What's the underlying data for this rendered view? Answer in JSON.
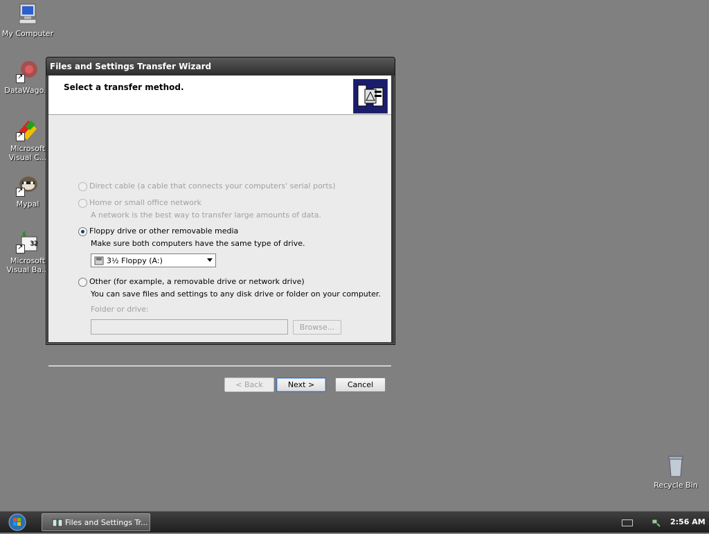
{
  "desktop": {
    "icons": [
      {
        "label": "My Computer",
        "icon": "computer-icon"
      },
      {
        "label": "DataWago...",
        "icon": "datawago-icon"
      },
      {
        "label": "Microsoft\nVisual C...",
        "label1": "Microsoft",
        "label2": "Visual C...",
        "icon": "visual-c-icon"
      },
      {
        "label": "Mypal",
        "icon": "mypal-icon"
      },
      {
        "label1": "Microsoft",
        "label2": "Visual Ba...",
        "icon": "visual-basic-icon"
      },
      {
        "label": "Recycle Bin",
        "icon": "recycle-bin-icon"
      }
    ]
  },
  "window": {
    "title": "Files and Settings Transfer Wizard",
    "heading": "Select a transfer method.",
    "options": [
      {
        "label": "Direct cable (a cable that connects your computers' serial ports)",
        "enabled": false,
        "checked": false
      },
      {
        "label": "Home or small office network",
        "description": "A network is the best way to transfer large amounts of data.",
        "enabled": false,
        "checked": false
      },
      {
        "label": "Floppy drive or other removable media",
        "description": "Make sure both computers have the same type of drive.",
        "enabled": true,
        "checked": true
      },
      {
        "label": "Other (for example, a removable drive or network drive)",
        "description": "You can save files and settings to any disk drive or folder on your computer.",
        "enabled": true,
        "checked": false
      }
    ],
    "drive_select": {
      "value": "3½ Floppy (A:)"
    },
    "folder_label": "Folder or drive:",
    "folder_value": "",
    "browse_label": "Browse...",
    "back_label": "< Back",
    "next_label": "Next >",
    "cancel_label": "Cancel"
  },
  "taskbar": {
    "task_label": "Files and Settings Tr...",
    "clock": "2:56 AM"
  },
  "colors": {
    "desktop": "#808080",
    "logo_bg": "#1b1d6b"
  }
}
